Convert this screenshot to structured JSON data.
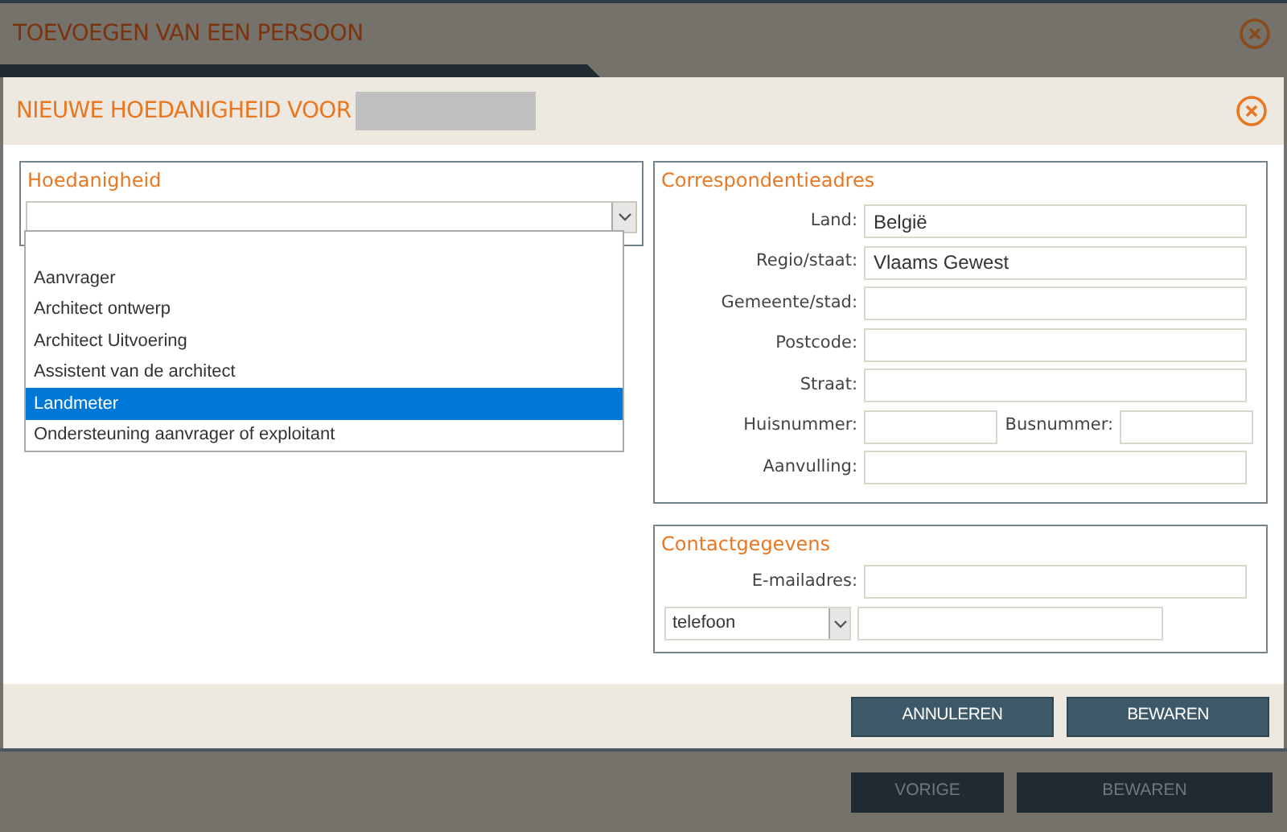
{
  "outer_window": {
    "title": "TOEVOEGEN VAN EEN PERSOON",
    "buttons": [
      {
        "label": "VORIGE"
      },
      {
        "label": "BEWAREN"
      }
    ]
  },
  "dialog": {
    "title": "NIEUWE HOEDANIGHEID VOOR",
    "capacity": {
      "legend": "Hoedanigheid",
      "expanded": true,
      "options": [
        {
          "label": "Aanvrager",
          "selected": false
        },
        {
          "label": "Architect ontwerp",
          "selected": false
        },
        {
          "label": "Architect Uitvoering",
          "selected": false
        },
        {
          "label": "Assistent van de architect",
          "selected": false
        },
        {
          "label": "Landmeter",
          "selected": true
        },
        {
          "label": "Ondersteuning aanvrager of exploitant",
          "selected": false
        }
      ]
    },
    "address": {
      "legend": "Correspondentieadres",
      "rows": [
        {
          "kind": "single",
          "fields": [
            {
              "label": "Land:",
              "value": "België"
            }
          ]
        },
        {
          "kind": "single",
          "fields": [
            {
              "label": "Regio/staat:",
              "value": "Vlaams Gewest"
            }
          ]
        },
        {
          "kind": "single",
          "fields": [
            {
              "label": "Gemeente/stad:"
            }
          ]
        },
        {
          "kind": "single",
          "fields": [
            {
              "label": "Postcode:"
            }
          ]
        },
        {
          "kind": "single",
          "fields": [
            {
              "label": "Straat:"
            }
          ]
        },
        {
          "kind": "pair",
          "fields": [
            {
              "label": "Huisnummer:"
            },
            {
              "label": "Busnummer:"
            }
          ]
        },
        {
          "kind": "single",
          "fields": [
            {
              "label": "Aanvulling:"
            }
          ]
        }
      ]
    },
    "contact": {
      "legend": "Contactgegevens",
      "email_label": "E-mailadres:",
      "phone_type": "telefoon"
    },
    "buttons": [
      {
        "label": "ANNULEREN"
      },
      {
        "label": "BEWAREN"
      }
    ]
  }
}
